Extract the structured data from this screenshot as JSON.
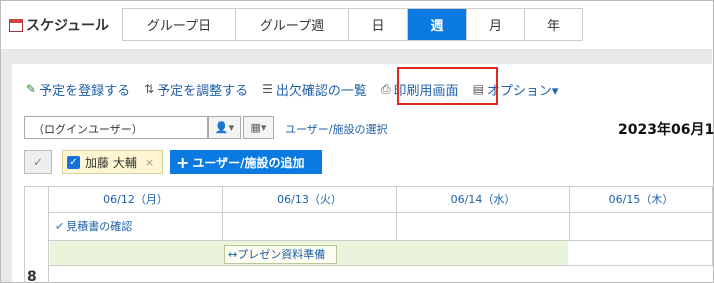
{
  "app": {
    "title": "スケジュール",
    "icon": "calendar-icon"
  },
  "view_tabs": [
    {
      "label": "グループ日",
      "active": false
    },
    {
      "label": "グループ週",
      "active": false
    },
    {
      "label": "日",
      "active": false
    },
    {
      "label": "週",
      "active": true
    },
    {
      "label": "月",
      "active": false
    },
    {
      "label": "年",
      "active": false
    }
  ],
  "toolbar": {
    "register": "予定を登録する",
    "adjust": "予定を調整する",
    "attendance": "出欠確認の一覧",
    "print": "印刷用画面",
    "options": "オプション▾"
  },
  "user_select": {
    "value": "（ログインユーザー）",
    "link": "ユーザー/施設の選択"
  },
  "date_header": "2023年06月1",
  "selected_user": {
    "name": "加藤 大輔",
    "remove": "×"
  },
  "add_user_button": "ユーザー/施設の追加",
  "days": [
    "06/12（月）",
    "06/13（火）",
    "06/14（水）",
    "06/15（木）"
  ],
  "events": {
    "todo": "見積書の確認",
    "span": "プレゼン資料準備"
  },
  "hour_label": "8",
  "colors": {
    "accent": "#0a7ae0",
    "link": "#1f5fa8",
    "highlight_border": "#e0281e"
  }
}
